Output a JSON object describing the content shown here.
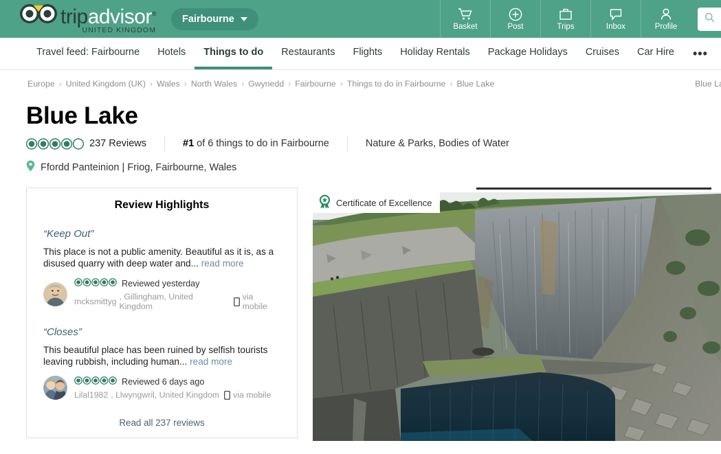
{
  "header": {
    "logo": {
      "trip": "trip",
      "advisor": "advisor",
      "tm": "®",
      "subtitle": "UNITED KINGDOM",
      "icon": "owl-logo-icon"
    },
    "geo_pill": {
      "label": "Fairbourne",
      "icon": "chevron-down-icon"
    },
    "nav": [
      {
        "label": "Basket",
        "icon": "shopping-cart-icon"
      },
      {
        "label": "Post",
        "icon": "plus-circle-icon"
      },
      {
        "label": "Trips",
        "icon": "briefcase-icon"
      },
      {
        "label": "Inbox",
        "icon": "speech-bubble-icon"
      },
      {
        "label": "Profile",
        "icon": "person-icon"
      }
    ],
    "search": {
      "icon": "search-icon",
      "placeholder": ""
    }
  },
  "subnav": {
    "items": [
      {
        "label": "Travel feed: Fairbourne",
        "active": false
      },
      {
        "label": "Hotels",
        "active": false
      },
      {
        "label": "Things to do",
        "active": true
      },
      {
        "label": "Restaurants",
        "active": false
      },
      {
        "label": "Flights",
        "active": false
      },
      {
        "label": "Holiday Rentals",
        "active": false
      },
      {
        "label": "Package Holidays",
        "active": false
      },
      {
        "label": "Cruises",
        "active": false
      },
      {
        "label": "Car Hire",
        "active": false
      }
    ],
    "more": "•••"
  },
  "breadcrumb": {
    "items": [
      "Europe",
      "United Kingdom (UK)",
      "Wales",
      "North Wales",
      "Gwynedd",
      "Fairbourne",
      "Things to do in Fairbourne",
      "Blue Lake"
    ],
    "separator": "›",
    "right_label": "Blue Lake, Fa"
  },
  "place": {
    "name": "Blue Lake",
    "rating": 4.5,
    "reviews_label": "237 Reviews",
    "rank_prefix": "#1",
    "rank_suffix": " of 6 things to do in Fairbourne",
    "categories": "Nature & Parks, Bodies of Water",
    "address": "Ffordd Panteinion | Friog, Fairbourne, Wales",
    "address_icon": "map-pin-icon"
  },
  "highlights": {
    "title": "Review Highlights",
    "read_all": "Read all 237 reviews",
    "reviews": [
      {
        "quote": "“Keep Out”",
        "body": "This place is not a public amenity. Beautiful as it is, as a disused quarry with deep water and... ",
        "read_more": "read more",
        "rating": 5,
        "when": "Reviewed yesterday",
        "author": "mcksmittyg",
        "location": ", Gillingham, United Kingdom",
        "via": "via mobile",
        "via_icon": "mobile-phone-icon",
        "avatar": "avatar-mcksmittyg"
      },
      {
        "quote": "“Closes”",
        "body": "This beautiful place has been ruined by selfish tourists leaving rubbish, including human... ",
        "read_more": "read more",
        "rating": 5,
        "when": "Reviewed 6 days ago",
        "author": "Lilal1982",
        "location": ", Llwyngwril, United Kingdom",
        "via": "via mobile",
        "via_icon": "mobile-phone-icon",
        "avatar": "avatar-lilal1982"
      }
    ]
  },
  "photo": {
    "badge_label": "Certificate of Excellence",
    "badge_icon": "award-ribbon-icon",
    "alt": "Blue Lake disused slate quarry with cliff face and deep blue water"
  },
  "colors": {
    "brand_green": "#4ea287",
    "pill_green": "#3f9079",
    "accent_underline": "#3e8e74",
    "bubble_green": "#2e7d64",
    "link_blue": "#6d8ca3"
  }
}
